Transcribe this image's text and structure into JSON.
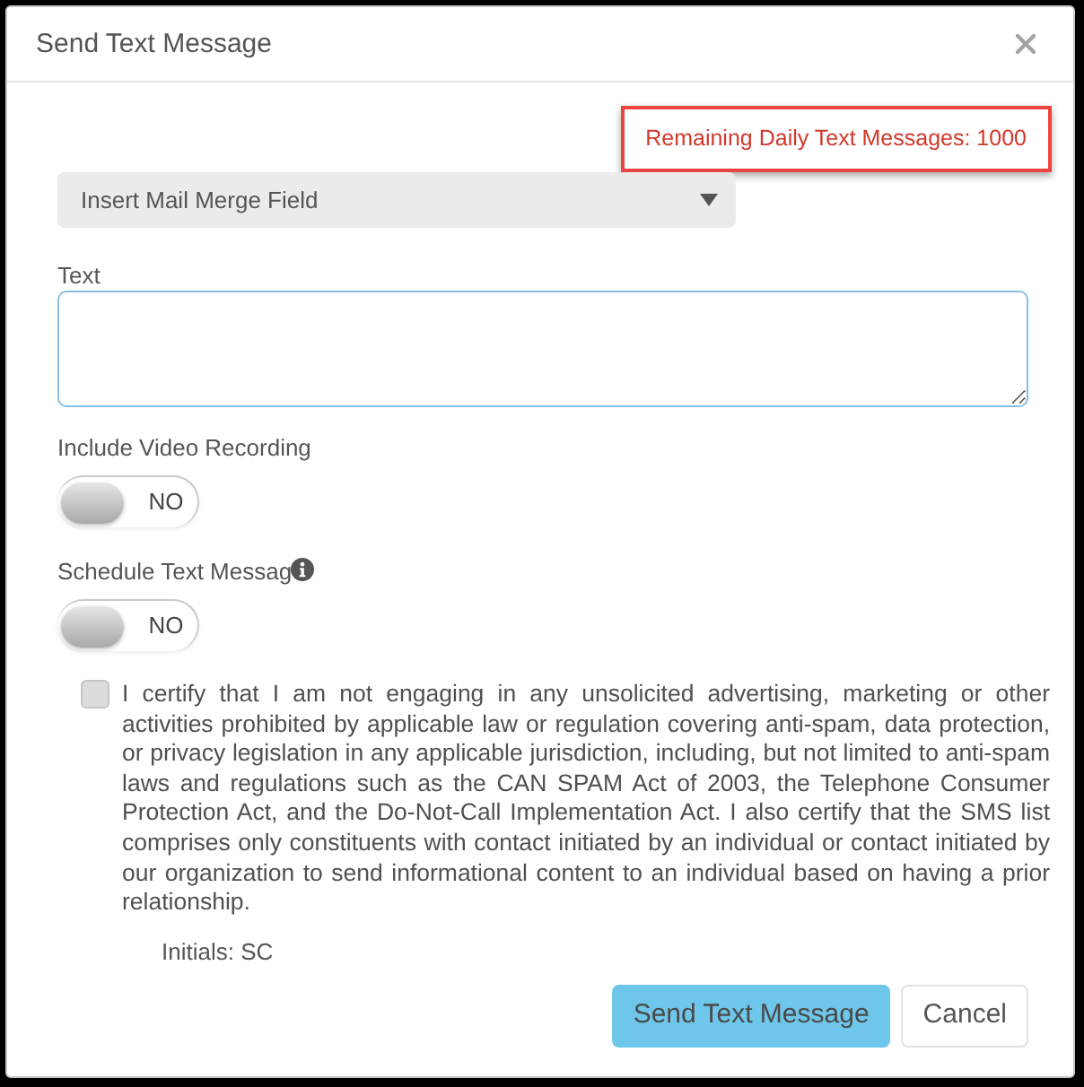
{
  "dialog": {
    "title": "Send Text Message"
  },
  "remaining_messages": "Remaining Daily Text Messages: 1000",
  "merge_field_select": {
    "value": "Insert Mail Merge Field"
  },
  "text_field": {
    "label": "Text"
  },
  "toggles": [
    {
      "label": "Include Video Recording",
      "on": false,
      "state_text": "NO",
      "info": false
    },
    {
      "label": "Schedule Text Messag",
      "on": false,
      "state_text": "NO",
      "info": true
    }
  ],
  "certification": {
    "checked": false,
    "text": "I certify that I am not engaging in any unsolicited advertising, marketing or other activities prohibited by applicable law or regulation covering anti-spam, data protection, or privacy legislation in any applicable jurisdiction, including, but not limited to anti-spam laws and regulations such as the CAN SPAM Act of 2003, the Telephone Consumer Protection Act, and the Do-Not-Call Implementation Act. I also certify that the SMS list comprises only constituents with contact initiated by an individual or contact initiated by our organization to send informational content to an individual based on having a prior relationship."
  },
  "initials": "Initials: SC",
  "buttons": [
    {
      "label": "Send Text Message",
      "kind": "primary"
    },
    {
      "label": "Cancel",
      "kind": "default"
    }
  ]
}
